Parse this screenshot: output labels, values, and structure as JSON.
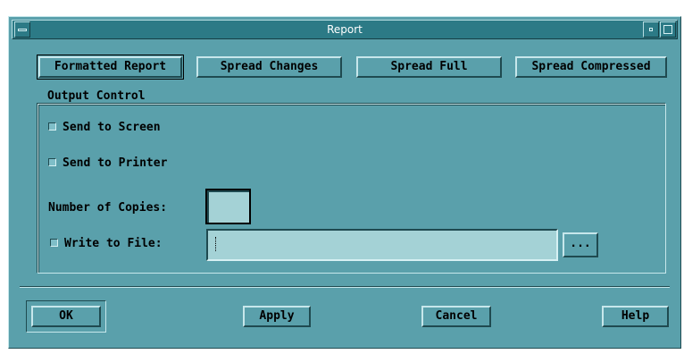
{
  "window": {
    "title": "Report"
  },
  "report_types": [
    {
      "label": "Formatted Report",
      "selected": true
    },
    {
      "label": "Spread Changes",
      "selected": false
    },
    {
      "label": "Spread Full",
      "selected": false
    },
    {
      "label": "Spread Compressed",
      "selected": false
    }
  ],
  "output_control": {
    "group_label": "Output Control",
    "send_to_screen": {
      "label": "Send to Screen",
      "checked": false
    },
    "send_to_printer": {
      "label": "Send to Printer",
      "checked": false
    },
    "copies_label": "Number of Copies:",
    "copies_value": "",
    "write_to_file": {
      "label": "Write to File:",
      "checked": false
    },
    "file_path_value": "",
    "browse_label": "..."
  },
  "actions": {
    "ok": "OK",
    "apply": "Apply",
    "cancel": "Cancel",
    "help": "Help"
  },
  "colors": {
    "background": "#5aa0ab",
    "title_bar": "#2c7a86",
    "field": "#a4d2d6"
  }
}
